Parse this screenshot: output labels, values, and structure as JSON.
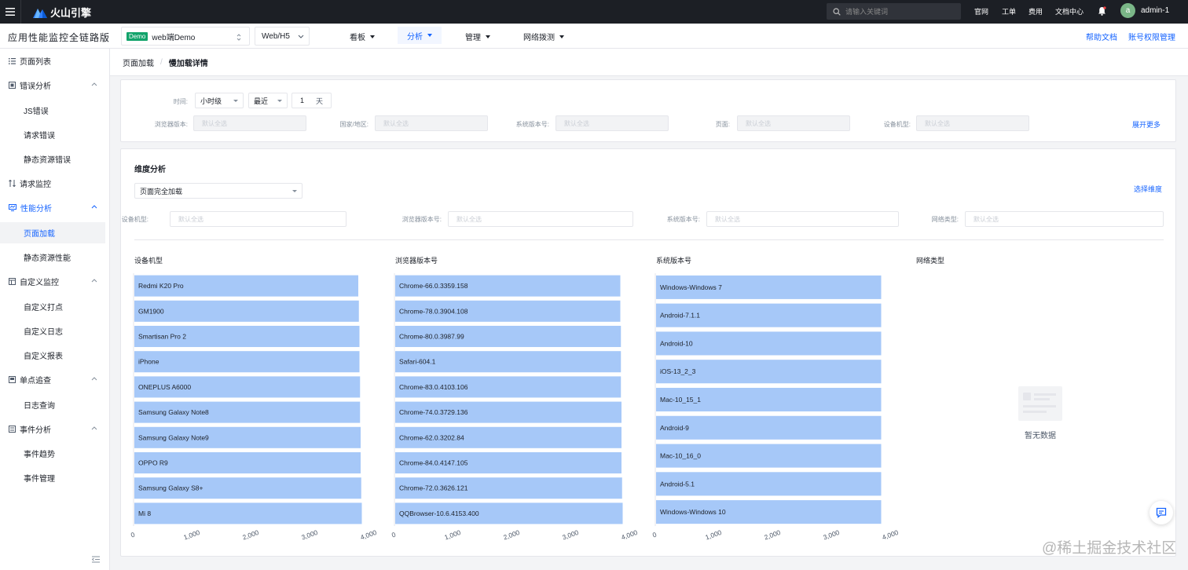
{
  "topbar": {
    "brand": "火山引擎",
    "search_placeholder": "请输入关键词",
    "links": [
      "官网",
      "工单",
      "费用",
      "文档中心"
    ],
    "avatar_letter": "a",
    "username": "admin-1"
  },
  "subnav": {
    "app_title": "应用性能监控全链路版",
    "app_badge": "Demo",
    "app_name": "web端Demo",
    "platform": "Web/H5",
    "nav": [
      {
        "label": "看板"
      },
      {
        "label": "分析"
      },
      {
        "label": "管理"
      },
      {
        "label": "网络拨测"
      }
    ],
    "help": "帮助文档",
    "perm": "账号权限管理"
  },
  "sidebar": {
    "items": [
      {
        "label": "页面列表"
      },
      {
        "label": "错误分析"
      },
      {
        "label": "JS错误"
      },
      {
        "label": "请求错误"
      },
      {
        "label": "静态资源错误"
      },
      {
        "label": "请求监控"
      },
      {
        "label": "性能分析"
      },
      {
        "label": "页面加载"
      },
      {
        "label": "静态资源性能"
      },
      {
        "label": "自定义监控"
      },
      {
        "label": "自定义打点"
      },
      {
        "label": "自定义日志"
      },
      {
        "label": "自定义报表"
      },
      {
        "label": "单点追查"
      },
      {
        "label": "日志查询"
      },
      {
        "label": "事件分析"
      },
      {
        "label": "事件趋势"
      },
      {
        "label": "事件管理"
      }
    ]
  },
  "breadcrumb": {
    "parent": "页面加载",
    "sep": "/",
    "current": "慢加载详情"
  },
  "filters": {
    "time_label": "时间:",
    "granularity": "小时级",
    "range": "最近",
    "count": "1",
    "unit": "天",
    "fields": [
      {
        "label": "浏览器版本:",
        "placeholder": "默认全选"
      },
      {
        "label": "国家/地区:",
        "placeholder": "默认全选"
      },
      {
        "label": "系统版本号:",
        "placeholder": "默认全选"
      },
      {
        "label": "页面:",
        "placeholder": "默认全选"
      },
      {
        "label": "设备机型:",
        "placeholder": "默认全选"
      }
    ],
    "expand": "展开更多"
  },
  "dimension": {
    "title": "维度分析",
    "metric": "页面完全加载",
    "choose": "选择维度",
    "fields": [
      {
        "label": "设备机型:",
        "placeholder": "默认全选"
      },
      {
        "label": "浏览器版本号:",
        "placeholder": "默认全选"
      },
      {
        "label": "系统版本号:",
        "placeholder": "默认全选"
      },
      {
        "label": "网络类型:",
        "placeholder": "默认全选"
      }
    ],
    "empty_text": "暂无数据",
    "empty_title": "网络类型"
  },
  "chart_data": [
    {
      "type": "bar",
      "orientation": "horizontal",
      "title": "设备机型",
      "xlim": [
        0,
        4000
      ],
      "ticks": [
        "0",
        "1,000",
        "2,000",
        "3,000",
        "4,000"
      ],
      "categories": [
        "Redmi K20 Pro",
        "GM1900",
        "Smartisan Pro 2",
        "iPhone",
        "ONEPLUS A6000",
        "Samsung Galaxy Note8",
        "Samsung Galaxy Note9",
        "OPPO R9",
        "Samsung Galaxy S8+",
        "Mi 8"
      ],
      "values": [
        3800,
        3810,
        3820,
        3820,
        3830,
        3830,
        3840,
        3840,
        3850,
        3860
      ]
    },
    {
      "type": "bar",
      "orientation": "horizontal",
      "title": "浏览器版本号",
      "xlim": [
        0,
        4000
      ],
      "ticks": [
        "0",
        "1,000",
        "2,000",
        "3,000",
        "4,000"
      ],
      "categories": [
        "Chrome-66.0.3359.158",
        "Chrome-78.0.3904.108",
        "Chrome-80.0.3987.99",
        "Safari-604.1",
        "Chrome-83.0.4103.106",
        "Chrome-74.0.3729.136",
        "Chrome-62.0.3202.84",
        "Chrome-84.0.4147.105",
        "Chrome-72.0.3626.121",
        "QQBrowser-10.6.4153.400"
      ],
      "values": [
        3820,
        3820,
        3830,
        3830,
        3830,
        3840,
        3840,
        3840,
        3850,
        3860
      ]
    },
    {
      "type": "bar",
      "orientation": "horizontal",
      "title": "系统版本号",
      "xlim": [
        0,
        4000
      ],
      "ticks": [
        "0",
        "1,000",
        "2,000",
        "3,000",
        "4,000"
      ],
      "categories": [
        "Windows-Windows 7",
        "Android-7.1.1",
        "Android-10",
        "iOS-13_2_3",
        "Mac-10_15_1",
        "Android-9",
        "Mac-10_16_0",
        "Android-5.1",
        "Windows-Windows 10"
      ],
      "values": [
        3820,
        3820,
        3820,
        3820,
        3820,
        3820,
        3820,
        3820,
        3820
      ]
    }
  ],
  "watermark": "@稀土掘金技术社区"
}
